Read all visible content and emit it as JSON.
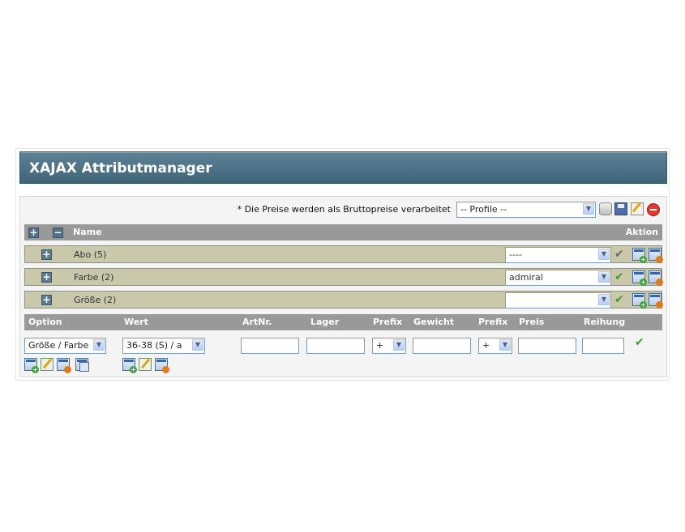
{
  "header": {
    "title": "XAJAX Attributmanager"
  },
  "toolbar": {
    "notice": "* Die Preise werden als Bruttopreise verarbeitet",
    "profile_select": "-- Profile --",
    "icons": [
      "database-icon",
      "save-icon",
      "edit-icon",
      "delete-icon"
    ]
  },
  "table": {
    "col_name": "Name",
    "col_action": "Aktion",
    "rows": [
      {
        "name": "Abo (5)",
        "select": "----",
        "check_color": "#6a6a6a"
      },
      {
        "name": "Farbe (2)",
        "select": "admiral",
        "check_color": "#3f9f2a"
      },
      {
        "name": "Größe (2)",
        "select": "",
        "check_color": "#3f9f2a"
      }
    ]
  },
  "form": {
    "headers": {
      "option": "Option",
      "wert": "Wert",
      "artnr": "ArtNr.",
      "lager": "Lager",
      "prefix1": "Prefix",
      "gewicht": "Gewicht",
      "prefix2": "Prefix",
      "preis": "Preis",
      "reihung": "Reihung"
    },
    "option_value": "Größe / Farbe",
    "wert_value": "36-38 (S) / a",
    "prefix1_value": "+",
    "prefix2_value": "+"
  },
  "colors": {
    "title_bar": "#4a6f84",
    "row_bg": "#cac8ab",
    "header_bg": "#999999"
  }
}
